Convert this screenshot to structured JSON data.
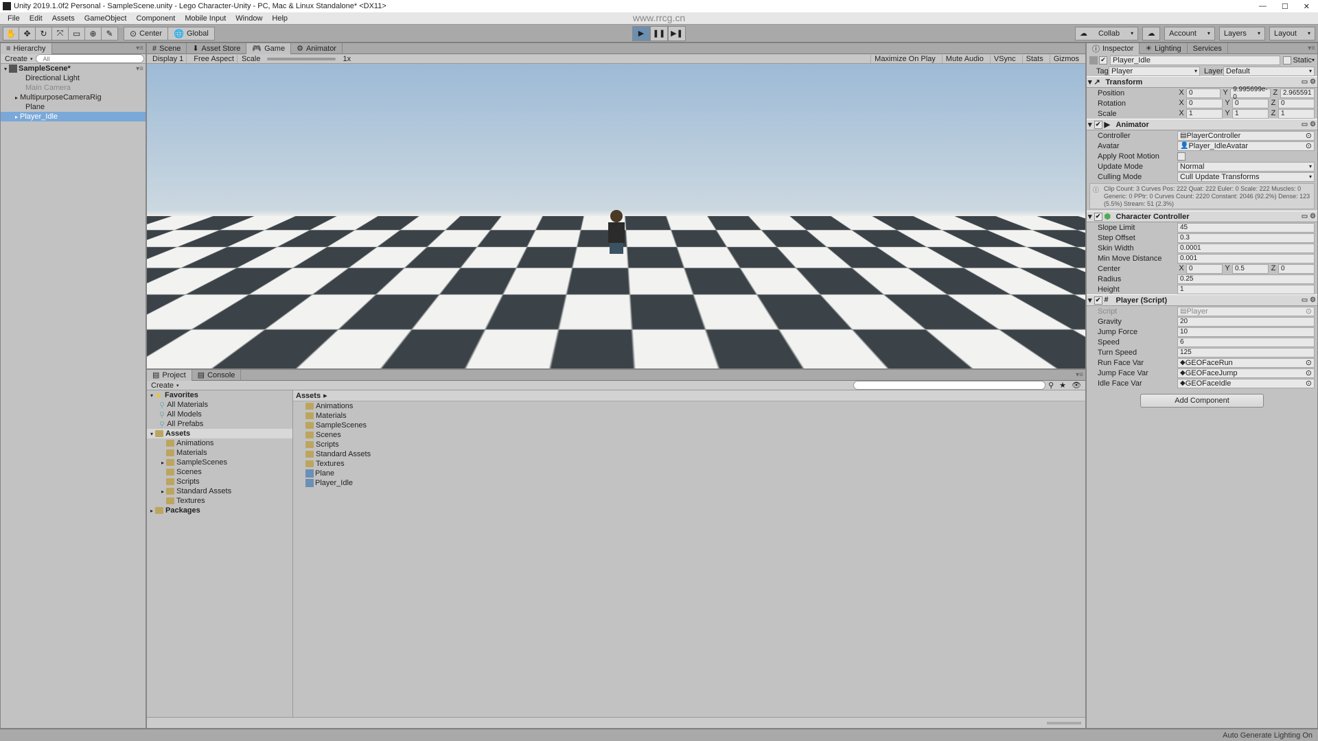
{
  "titlebar": {
    "title": "Unity 2019.1.0f2 Personal - SampleScene.unity - Lego Character-Unity - PC, Mac & Linux Standalone* <DX11>"
  },
  "menu": {
    "file": "File",
    "edit": "Edit",
    "assets": "Assets",
    "gameobject": "GameObject",
    "component": "Component",
    "mobile_input": "Mobile Input",
    "window": "Window",
    "help": "Help"
  },
  "toolbar": {
    "center": "Center",
    "global": "Global",
    "collab": "Collab",
    "account": "Account",
    "layers": "Layers",
    "layout": "Layout"
  },
  "hierarchy": {
    "title": "Hierarchy",
    "create": "Create",
    "search_placeholder": "All",
    "scene": "SampleScene*",
    "items": [
      {
        "label": "Directional Light"
      },
      {
        "label": "Main Camera",
        "dim": true
      },
      {
        "label": "MultipurposeCameraRig"
      },
      {
        "label": "Plane"
      },
      {
        "label": "Player_Idle",
        "selected": true
      }
    ]
  },
  "center_tabs": {
    "scene": "Scene",
    "asset_store": "Asset Store",
    "game": "Game",
    "animator": "Animator"
  },
  "game_toolbar": {
    "display": "Display 1",
    "aspect": "Free Aspect",
    "scale": "Scale",
    "scale_val": "1x",
    "max": "Maximize On Play",
    "mute": "Mute Audio",
    "vsync": "VSync",
    "stats": "Stats",
    "gizmos": "Gizmos"
  },
  "project": {
    "title": "Project",
    "console": "Console",
    "create": "Create",
    "favorites": "Favorites",
    "fav_items": [
      "All Materials",
      "All Models",
      "All Prefabs"
    ],
    "assets": "Assets",
    "asset_folders": [
      "Animations",
      "Materials",
      "SampleScenes",
      "Scenes",
      "Scripts",
      "Standard Assets",
      "Textures"
    ],
    "packages": "Packages",
    "breadcrumb": "Assets",
    "content_items": [
      {
        "label": "Animations",
        "type": "folder"
      },
      {
        "label": "Materials",
        "type": "folder"
      },
      {
        "label": "SampleScenes",
        "type": "folder"
      },
      {
        "label": "Scenes",
        "type": "folder"
      },
      {
        "label": "Scripts",
        "type": "folder"
      },
      {
        "label": "Standard Assets",
        "type": "folder"
      },
      {
        "label": "Textures",
        "type": "folder"
      },
      {
        "label": "Plane",
        "type": "prefab"
      },
      {
        "label": "Player_Idle",
        "type": "prefab"
      }
    ]
  },
  "inspector": {
    "tabs": {
      "inspector": "Inspector",
      "lighting": "Lighting",
      "services": "Services"
    },
    "header": {
      "name": "Player_Idle",
      "static": "Static",
      "tag_label": "Tag",
      "tag": "Player",
      "layer_label": "Layer",
      "layer": "Default"
    },
    "transform": {
      "title": "Transform",
      "position": {
        "label": "Position",
        "x": "0",
        "y": "9.995699e-0",
        "z": "2.965591"
      },
      "rotation": {
        "label": "Rotation",
        "x": "0",
        "y": "0",
        "z": "0"
      },
      "scale": {
        "label": "Scale",
        "x": "1",
        "y": "1",
        "z": "1"
      }
    },
    "animator": {
      "title": "Animator",
      "controller": {
        "label": "Controller",
        "value": "PlayerController"
      },
      "avatar": {
        "label": "Avatar",
        "value": "Player_IdleAvatar"
      },
      "apply_root": {
        "label": "Apply Root Motion"
      },
      "update_mode": {
        "label": "Update Mode",
        "value": "Normal"
      },
      "culling_mode": {
        "label": "Culling Mode",
        "value": "Cull Update Transforms"
      },
      "info": "Clip Count: 3\nCurves Pos: 222 Quat: 222 Euler: 0 Scale: 222 Muscles: 0 Generic: 0 PPtr: 0\nCurves Count: 2220 Constant: 2046 (92.2%) Dense: 123 (5.5%) Stream: 51 (2.3%)"
    },
    "char_controller": {
      "title": "Character Controller",
      "slope": {
        "label": "Slope Limit",
        "value": "45"
      },
      "step": {
        "label": "Step Offset",
        "value": "0.3"
      },
      "skin": {
        "label": "Skin Width",
        "value": "0.0001"
      },
      "minmove": {
        "label": "Min Move Distance",
        "value": "0.001"
      },
      "center": {
        "label": "Center",
        "x": "0",
        "y": "0.5",
        "z": "0"
      },
      "radius": {
        "label": "Radius",
        "value": "0.25"
      },
      "height": {
        "label": "Height",
        "value": "1"
      }
    },
    "player_script": {
      "title": "Player (Script)",
      "script": {
        "label": "Script",
        "value": "Player"
      },
      "gravity": {
        "label": "Gravity",
        "value": "20"
      },
      "jump_force": {
        "label": "Jump Force",
        "value": "10"
      },
      "speed": {
        "label": "Speed",
        "value": "6"
      },
      "turn_speed": {
        "label": "Turn Speed",
        "value": "125"
      },
      "run_face": {
        "label": "Run Face Var",
        "value": "GEOFaceRun"
      },
      "jump_face": {
        "label": "Jump Face Var",
        "value": "GEOFaceJump"
      },
      "idle_face": {
        "label": "Idle Face Var",
        "value": "GEOFaceIdle"
      }
    },
    "add_component": "Add Component"
  },
  "statusbar": {
    "text": "Auto Generate Lighting On"
  },
  "watermark": "www.rrcg.cn"
}
